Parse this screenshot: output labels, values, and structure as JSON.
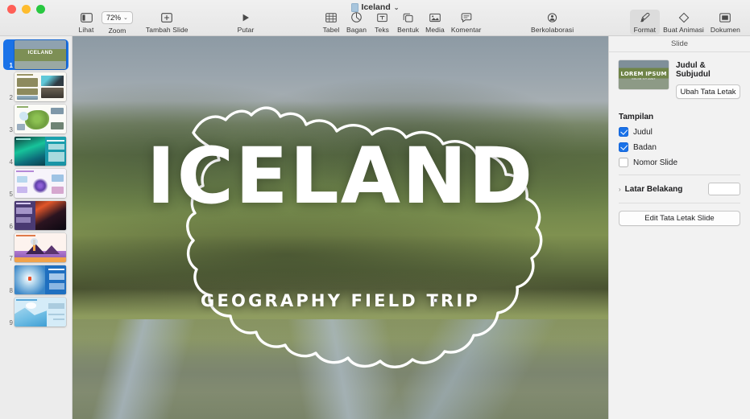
{
  "window": {
    "title": "Iceland",
    "title_icon": "document-icon",
    "chevron": "⌄",
    "traffic_lights": [
      "close-button",
      "minimize-button",
      "zoom-button"
    ]
  },
  "toolbar": {
    "left_group": [
      {
        "label": "Lihat",
        "icon": "view-sidebar-icon",
        "name": "view-button"
      }
    ],
    "zoom": {
      "label": "Zoom",
      "value": "72%",
      "chevron": "⌄"
    },
    "add_slide": {
      "label": "Tambah Slide",
      "icon": "plus-box-icon"
    },
    "play": {
      "label": "Putar",
      "icon": "play-icon"
    },
    "insert_group": [
      {
        "label": "Tabel",
        "icon": "table-icon"
      },
      {
        "label": "Bagan",
        "icon": "chart-icon"
      },
      {
        "label": "Teks",
        "icon": "text-box-icon"
      },
      {
        "label": "Bentuk",
        "icon": "shapes-icon"
      },
      {
        "label": "Media",
        "icon": "media-image-icon"
      },
      {
        "label": "Komentar",
        "icon": "comment-icon"
      }
    ],
    "collaborate": {
      "label": "Berkolaborasi",
      "icon": "collaborate-person-icon"
    },
    "right_group": [
      {
        "label": "Format",
        "icon": "paintbrush-icon",
        "active": true
      },
      {
        "label": "Buat Animasi",
        "icon": "animate-diamond-icon",
        "active": false
      },
      {
        "label": "Dokumen",
        "icon": "document-panel-icon",
        "active": false
      }
    ]
  },
  "navigator": {
    "slides": [
      {
        "number": "1",
        "selected": true,
        "art": "tb1"
      },
      {
        "number": "2",
        "selected": false,
        "art": "tb2"
      },
      {
        "number": "3",
        "selected": false,
        "art": "tb3"
      },
      {
        "number": "4",
        "selected": false,
        "art": "tb4"
      },
      {
        "number": "5",
        "selected": false,
        "art": "tb5"
      },
      {
        "number": "6",
        "selected": false,
        "art": "tb6"
      },
      {
        "number": "7",
        "selected": false,
        "art": "tb7"
      },
      {
        "number": "8",
        "selected": false,
        "art": "tb8"
      },
      {
        "number": "9",
        "selected": false,
        "art": "tb9"
      }
    ]
  },
  "canvas": {
    "slide_title": "ICELAND",
    "slide_subtitle": "GEOGRAPHY FIELD TRIP"
  },
  "inspector": {
    "tab_label": "Slide",
    "layout": {
      "thumb_text": "LOREM IPSUM",
      "thumb_subtext": "DOLOR SIT AMET",
      "name": "Judul & Subjudul",
      "change_button": "Ubah Tata Letak"
    },
    "appearance": {
      "title": "Tampilan",
      "options": [
        {
          "label": "Judul",
          "checked": true
        },
        {
          "label": "Badan",
          "checked": true
        },
        {
          "label": "Nomor Slide",
          "checked": false
        }
      ]
    },
    "background": {
      "label": "Latar Belakang",
      "disclosure": "›",
      "color": "#ffffff"
    },
    "edit_layout_button": "Edit Tata Letak Slide"
  },
  "colors": {
    "accent": "#1a72e8",
    "toolbar_bg": "#ececec",
    "inspector_bg": "#f2f2f2",
    "canvas_bg": "#c8c8c8"
  }
}
